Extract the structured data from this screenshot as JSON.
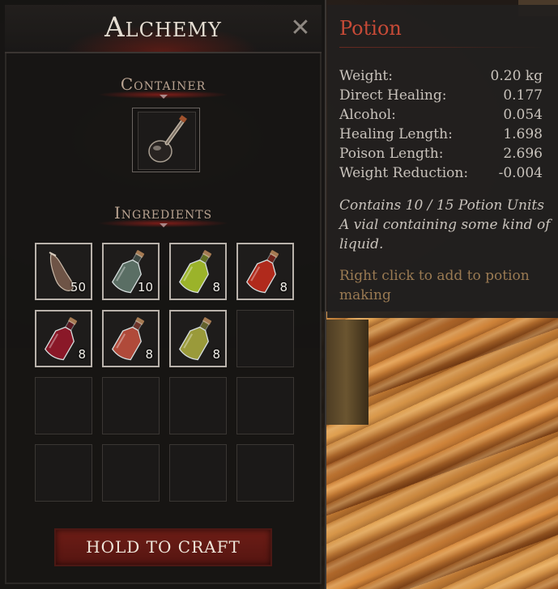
{
  "panel": {
    "title": "Alchemy",
    "close_icon": "close-icon",
    "container_label": "Container",
    "ingredients_label": "Ingredients",
    "craft_label": "HOLD TO CRAFT"
  },
  "container": {
    "icon": "flask-icon"
  },
  "ingredients": [
    {
      "icon": "leather-pouch-icon",
      "count": "50",
      "color": "#8a6a5a"
    },
    {
      "icon": "potion-bottle-icon",
      "count": "10",
      "color": "#5a6e64"
    },
    {
      "icon": "potion-bottle-icon",
      "count": "8",
      "color": "#9bb32a"
    },
    {
      "icon": "potion-bottle-icon",
      "count": "8",
      "color": "#b02a1c"
    },
    {
      "icon": "potion-bottle-icon",
      "count": "8",
      "color": "#8a1828"
    },
    {
      "icon": "potion-bottle-icon",
      "count": "8",
      "color": "#b04a3a"
    },
    {
      "icon": "potion-bottle-icon",
      "count": "8",
      "color": "#9a9a3a"
    },
    {
      "icon": "",
      "count": ""
    },
    {
      "icon": "",
      "count": ""
    },
    {
      "icon": "",
      "count": ""
    },
    {
      "icon": "",
      "count": ""
    },
    {
      "icon": "",
      "count": ""
    },
    {
      "icon": "",
      "count": ""
    },
    {
      "icon": "",
      "count": ""
    },
    {
      "icon": "",
      "count": ""
    },
    {
      "icon": "",
      "count": ""
    }
  ],
  "tooltip": {
    "title": "Potion",
    "stats": [
      {
        "label": "Weight:",
        "value": "0.20 kg"
      },
      {
        "label": "Direct Healing:",
        "value": "0.177"
      },
      {
        "label": "Alcohol:",
        "value": "0.054"
      },
      {
        "label": "Healing Length:",
        "value": "1.698"
      },
      {
        "label": "Poison Length:",
        "value": "2.696"
      },
      {
        "label": "Weight Reduction:",
        "value": "-0.004"
      }
    ],
    "description": "Contains 10 / 15 Potion Units A vial containing some kind of liquid.",
    "hint": "Right click to add to potion making"
  }
}
